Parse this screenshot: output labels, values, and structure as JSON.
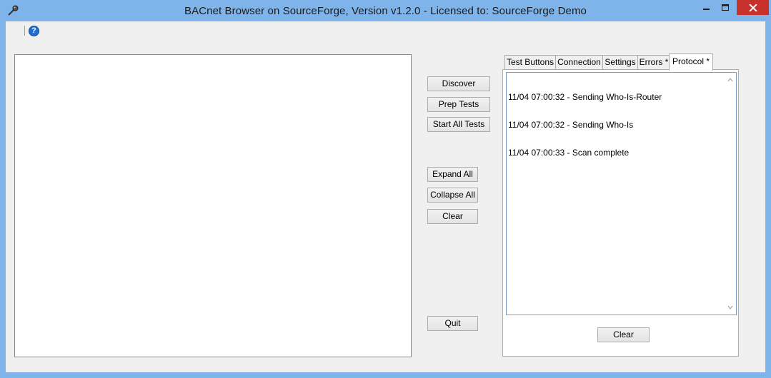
{
  "window": {
    "title": "BACnet Browser on SourceForge, Version v1.2.0 - Licensed to: SourceForge Demo"
  },
  "menu": {
    "help_icon": "?"
  },
  "buttons": {
    "discover": "Discover",
    "prep_tests": "Prep Tests",
    "start_all_tests": "Start All Tests",
    "expand_all": "Expand All",
    "collapse_all": "Collapse All",
    "clear": "Clear",
    "quit": "Quit"
  },
  "tabs": [
    {
      "label": "Test Buttons"
    },
    {
      "label": "Connection"
    },
    {
      "label": "Settings"
    },
    {
      "label": "Errors *"
    },
    {
      "label": "Protocol *"
    }
  ],
  "protocol": {
    "log": [
      "11/04 07:00:32 - Sending Who-Is-Router",
      "11/04 07:00:32 - Sending Who-Is",
      "11/04 07:00:33 - Scan complete"
    ],
    "clear_label": "Clear"
  },
  "icons": {
    "app": "microphone-probe-icon",
    "minimize": "minimize-icon",
    "maximize": "maximize-icon",
    "close": "close-icon",
    "help": "help-icon",
    "scroll_up": "scroll-up-arrow-icon",
    "scroll_down": "scroll-down-arrow-icon"
  },
  "colors": {
    "titlebar": "#7eb4ea",
    "close_button": "#c7302b",
    "client_bg": "#f0f0f0"
  }
}
